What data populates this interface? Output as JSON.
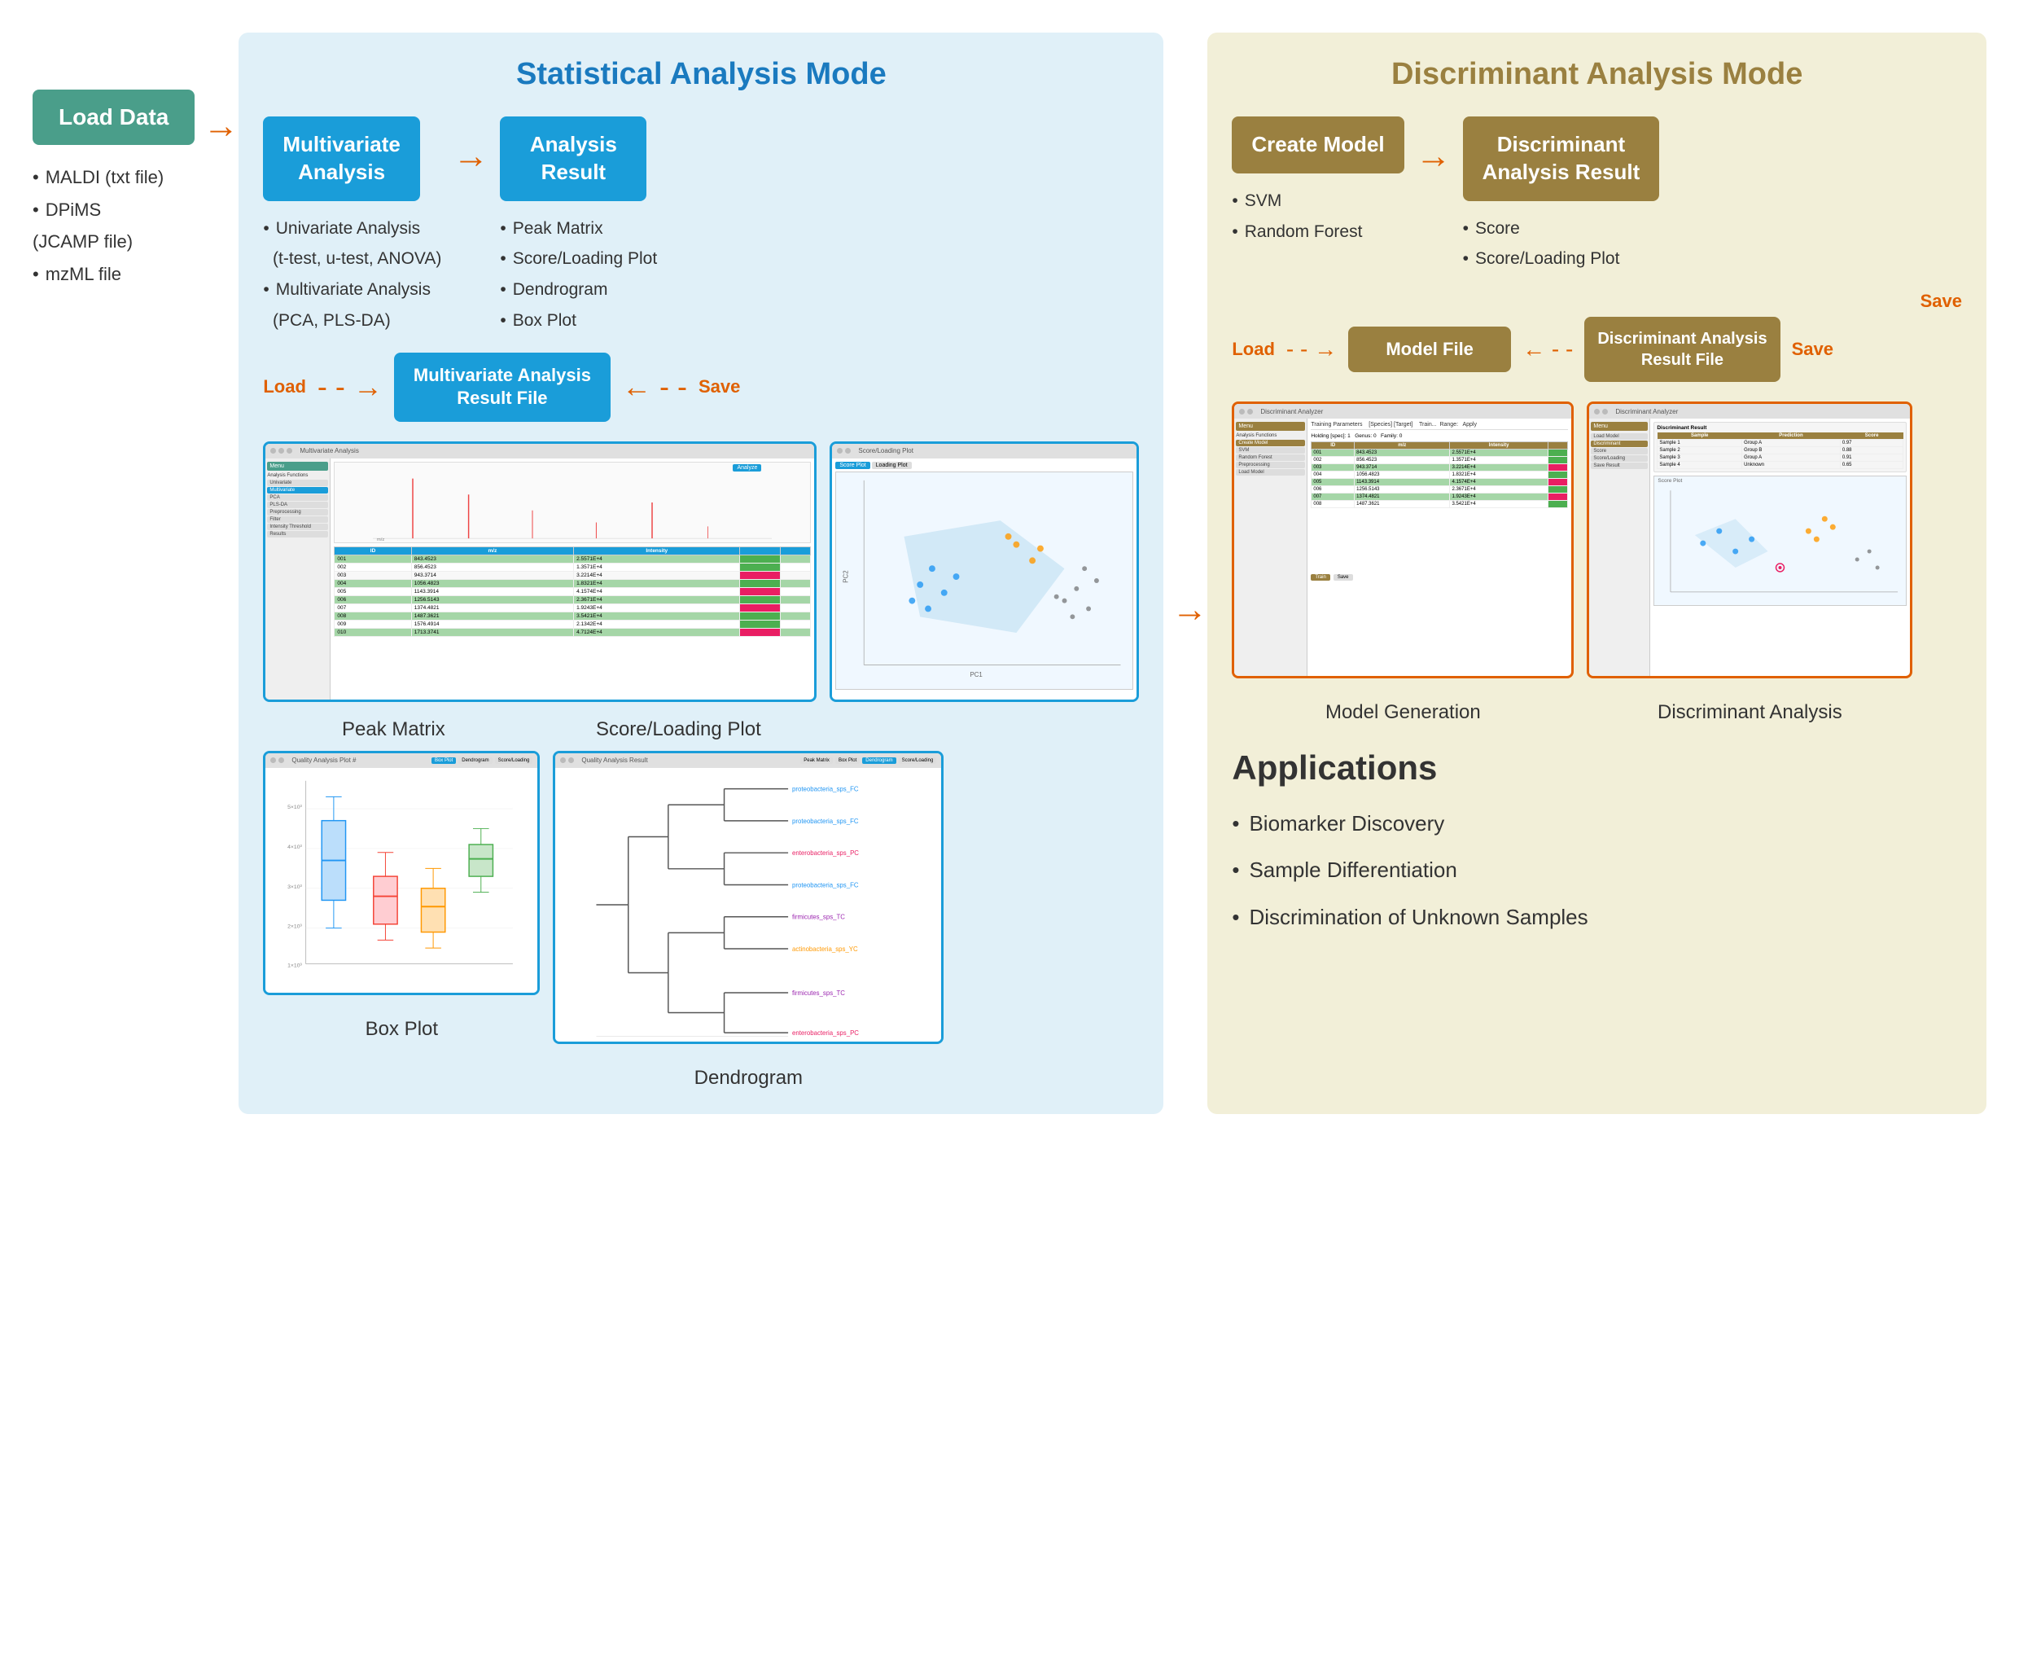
{
  "page": {
    "load_data": {
      "label": "Load Data",
      "items": [
        "MALDI (txt file)",
        "DPiMS (JCAMP file)",
        "mzML file"
      ]
    },
    "statistical_section": {
      "title": "Statistical Analysis Mode",
      "flow": {
        "box1_line1": "Multivariate",
        "box1_line2": "Analysis",
        "arrow1": "→",
        "box2_line1": "Analysis",
        "box2_line2": "Result",
        "bullets1": [
          "Univariate Analysis (t-test, u-test, ANOVA)",
          "Multivariate Analysis (PCA, PLS-DA)"
        ],
        "bullets2": [
          "Peak Matrix",
          "Score/Loading Plot",
          "Dendrogram",
          "Box Plot"
        ],
        "load_label": "Load",
        "save_label": "Save",
        "result_file_line1": "Multivariate Analysis",
        "result_file_line2": "Result File"
      },
      "screenshots": {
        "peak_matrix_label": "Peak Matrix",
        "score_loading_label": "Score/Loading Plot",
        "box_plot_label": "Box Plot",
        "dendrogram_label": "Dendrogram"
      }
    },
    "discriminant_section": {
      "title": "Discriminant Analysis Mode",
      "flow": {
        "box1_line1": "Create Model",
        "box2_line1": "Discriminant",
        "box2_line2": "Analysis Result",
        "bullets1": [
          "SVM",
          "Random Forest"
        ],
        "bullets2": [
          "Score",
          "Score/Loading Plot"
        ],
        "load_label": "Load",
        "save_label": "Save",
        "save2_label": "Save",
        "model_file_label": "Model File",
        "result_file_line1": "Discriminant Analysis",
        "result_file_line2": "Result File"
      },
      "screenshots": {
        "model_gen_label": "Model Generation",
        "disc_analysis_label": "Discriminant Analysis"
      }
    },
    "applications": {
      "title": "Applications",
      "items": [
        "Biomarker Discovery",
        "Sample Differentiation",
        "Discrimination of Unknown Samples"
      ]
    }
  }
}
